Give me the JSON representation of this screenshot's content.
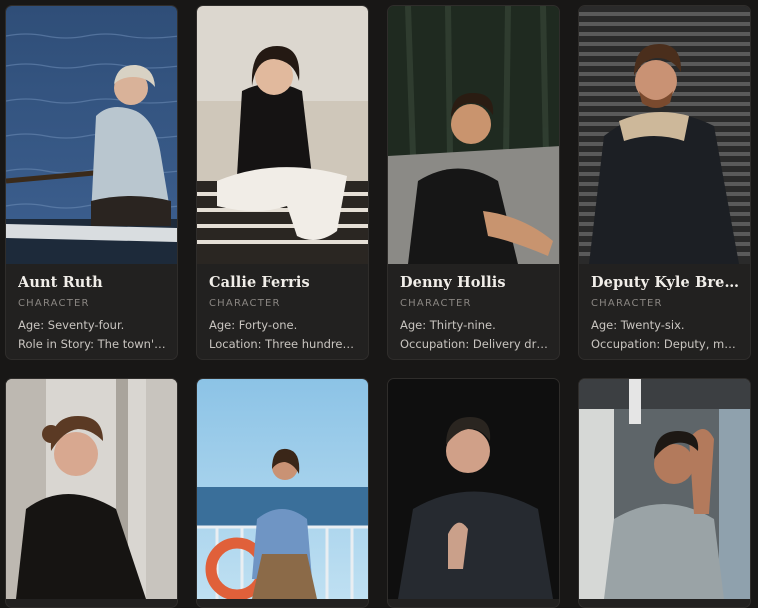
{
  "cards": [
    {
      "name": "Aunt Ruth",
      "type": "CHARACTER",
      "line1": "Age: Seventy-four.",
      "line2": "Role in Story: The town's historian"
    },
    {
      "name": "Callie Ferris",
      "type": "CHARACTER",
      "line1": "Age: Forty-one.",
      "line2": "Location: Three hundred miles away"
    },
    {
      "name": "Denny Hollis",
      "type": "CHARACTER",
      "line1": "Age: Thirty-nine.",
      "line2": "Occupation: Delivery driver"
    },
    {
      "name": "Deputy Kyle Brennan",
      "type": "CHARACTER",
      "line1": "Age: Twenty-six.",
      "line2": "Occupation: Deputy, marshal"
    },
    {
      "name": "",
      "type": "",
      "line1": "",
      "line2": ""
    },
    {
      "name": "",
      "type": "",
      "line1": "",
      "line2": ""
    },
    {
      "name": "",
      "type": "",
      "line1": "",
      "line2": ""
    },
    {
      "name": "",
      "type": "",
      "line1": "",
      "line2": ""
    }
  ]
}
